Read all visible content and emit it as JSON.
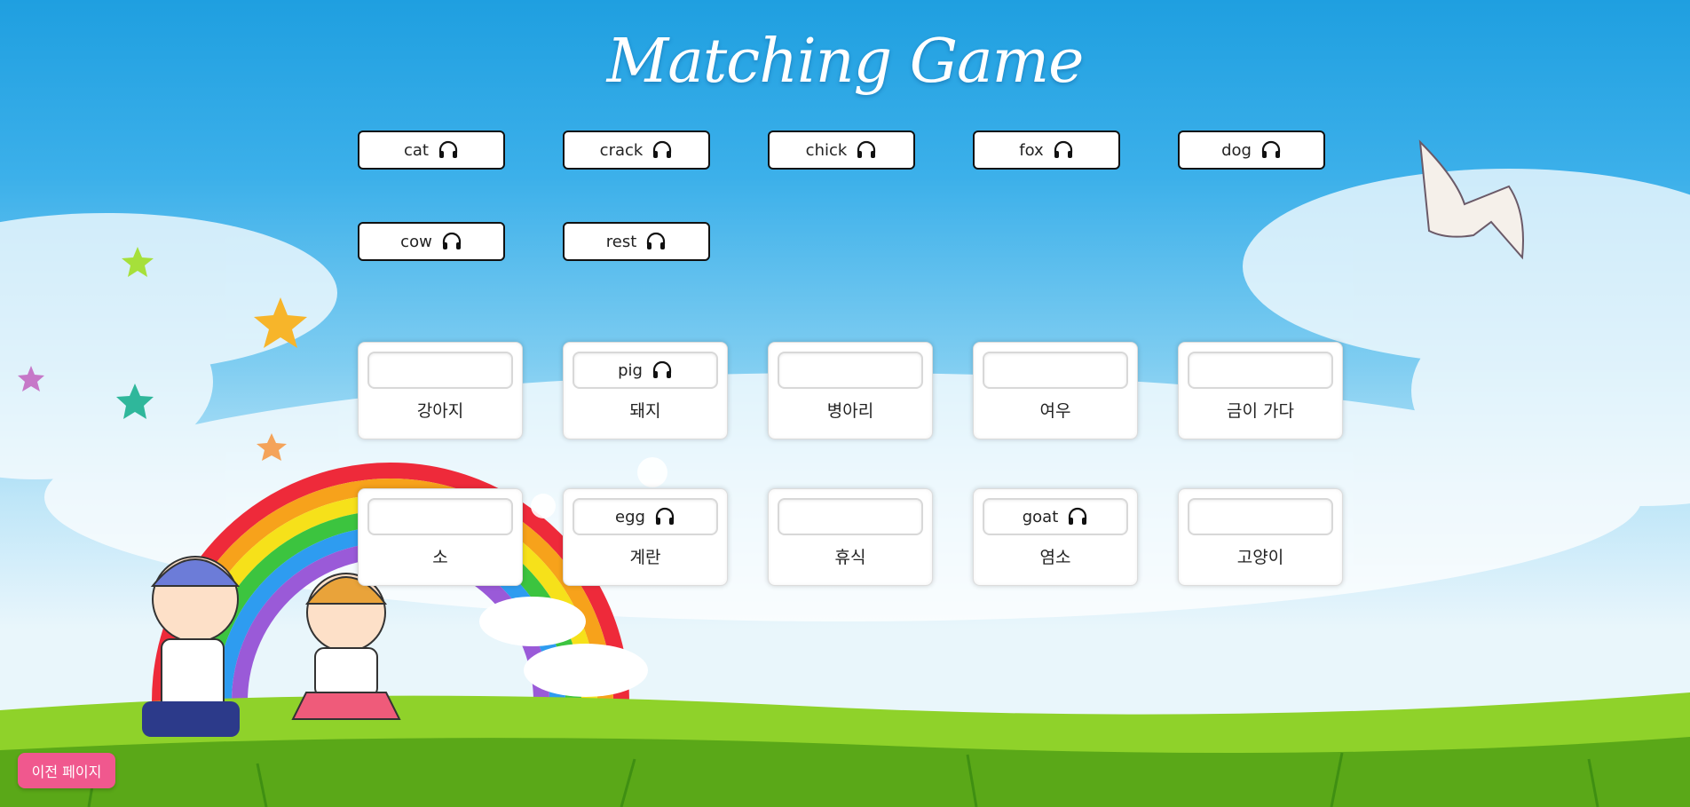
{
  "title": "Matching Game",
  "word_bank": [
    {
      "word": "cat",
      "icon": "headphones-icon"
    },
    {
      "word": "crack",
      "icon": "headphones-icon"
    },
    {
      "word": "chick",
      "icon": "headphones-icon"
    },
    {
      "word": "fox",
      "icon": "headphones-icon"
    },
    {
      "word": "dog",
      "icon": "headphones-icon"
    },
    {
      "word": "cow",
      "icon": "headphones-icon"
    },
    {
      "word": "rest",
      "icon": "headphones-icon"
    }
  ],
  "cards": [
    {
      "meaning": "강아지",
      "placed": ""
    },
    {
      "meaning": "돼지",
      "placed": "pig"
    },
    {
      "meaning": "병아리",
      "placed": ""
    },
    {
      "meaning": "여우",
      "placed": ""
    },
    {
      "meaning": "금이 가다",
      "placed": ""
    },
    {
      "meaning": "소",
      "placed": ""
    },
    {
      "meaning": "계란",
      "placed": "egg"
    },
    {
      "meaning": "휴식",
      "placed": ""
    },
    {
      "meaning": "염소",
      "placed": "goat"
    },
    {
      "meaning": "고양이",
      "placed": ""
    }
  ],
  "prev_button": "이전 페이지",
  "colors": {
    "sky": "#1f9fe0",
    "grass": "#7cc620",
    "prev_button": "#f0588e"
  }
}
